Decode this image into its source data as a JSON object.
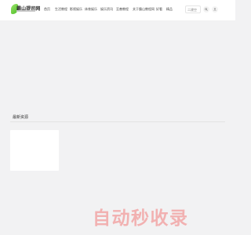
{
  "header": {
    "logo_text": "霸山提司网",
    "nav": [
      {
        "label": "首页"
      },
      {
        "label": "生活教程"
      },
      {
        "label": "影视娱乐"
      },
      {
        "label": "体育娱乐"
      },
      {
        "label": "娱乐资讯"
      },
      {
        "label": "至善教程"
      },
      {
        "label": "关于霸山教程网"
      },
      {
        "label": "好看"
      },
      {
        "label": "精品"
      }
    ],
    "search": {
      "placeholder": "二建空"
    },
    "icons": [
      "search-icon",
      "user-icon"
    ]
  },
  "main": {
    "section_title": "最新资源"
  },
  "watermark": {
    "text": "自动秒收录"
  },
  "colors": {
    "accent": "#4fbf2a",
    "watermark": "#f2a6a6",
    "background": "#f2f2f3"
  }
}
